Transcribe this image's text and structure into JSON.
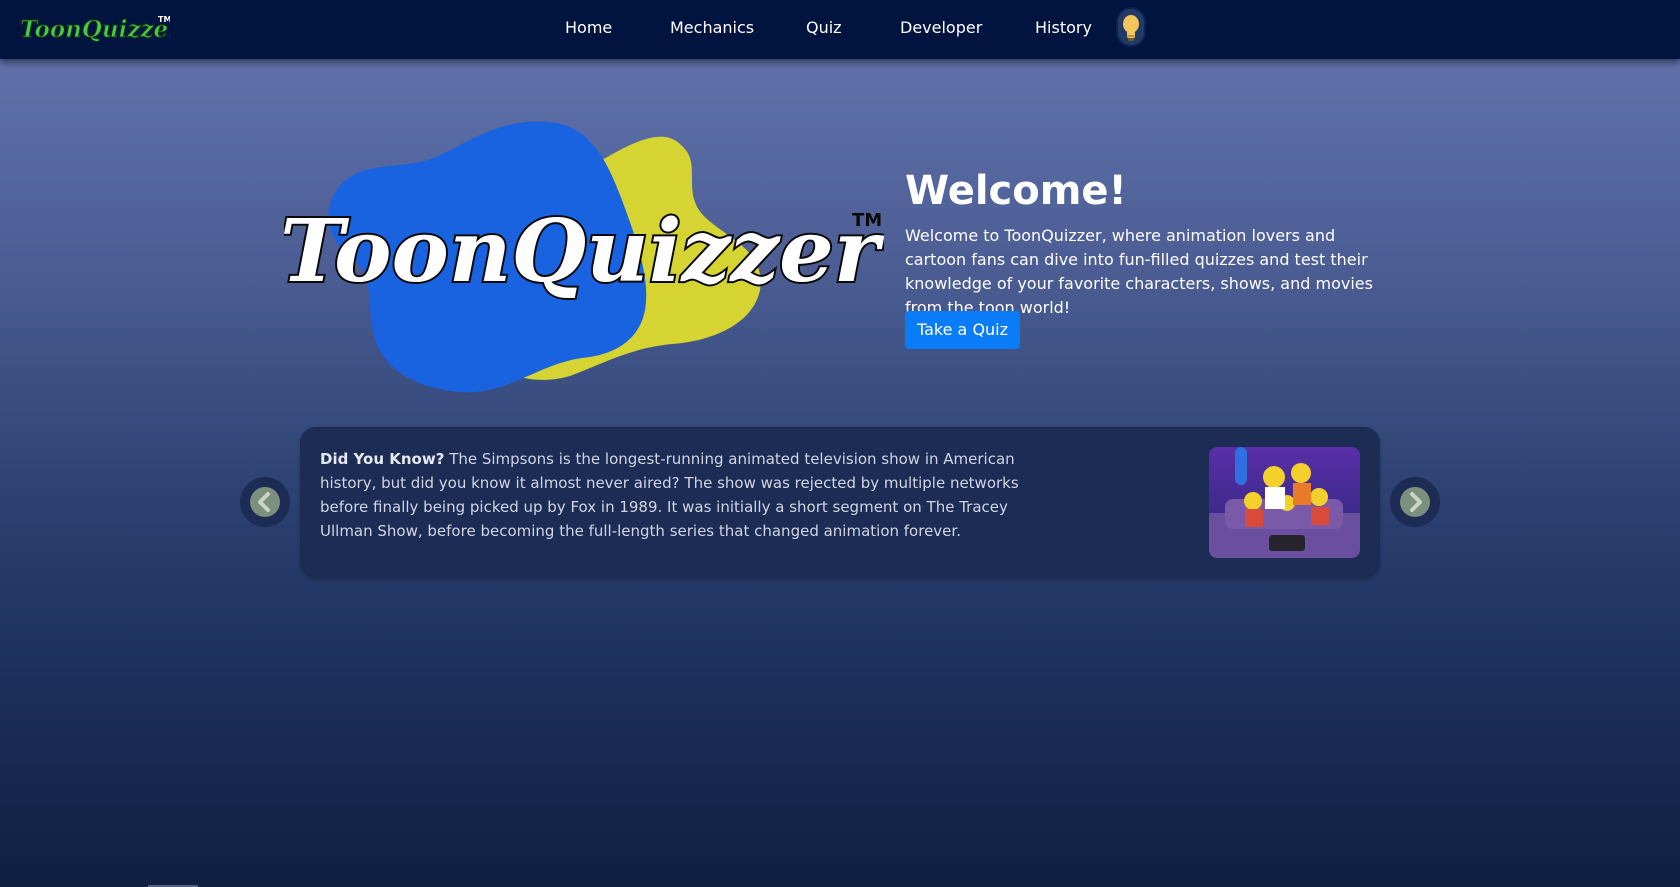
{
  "navbar": {
    "brand": "ToonQuizzer",
    "brand_tm": "TM",
    "links": [
      {
        "label": "Home"
      },
      {
        "label": "Mechanics"
      },
      {
        "label": "Quiz"
      },
      {
        "label": "Developer"
      },
      {
        "label": "History"
      }
    ],
    "theme_toggle_icon": "lightbulb-icon"
  },
  "hero": {
    "logo_text": "ToonQuizzer",
    "logo_tm": "TM",
    "title": "Welcome!",
    "description": "Welcome to ToonQuizzer, where animation lovers and cartoon fans can dive into fun-filled quizzes and test their knowledge of your favorite characters, shows, and movies from the toon world!",
    "cta_label": "Take a Quiz"
  },
  "fact": {
    "lead": "Did You Know?",
    "text": " The Simpsons is the longest-running animated television show in American history, but did you know it almost never aired? The show was rejected by multiple networks before finally being picked up by Fox in 1989. It was initially a short segment on The Tracey Ullman Show, before becoming the full-length series that changed animation forever.",
    "prev_icon": "chevron-left-icon",
    "next_icon": "chevron-right-icon"
  },
  "colors": {
    "navbar": "#01133f",
    "brand_green": "#4ec64a",
    "logo_blue": "#1a63e0",
    "logo_yellow": "#d6d433",
    "button_blue": "#0a7cf8",
    "card_bg": "#1c2c55"
  }
}
